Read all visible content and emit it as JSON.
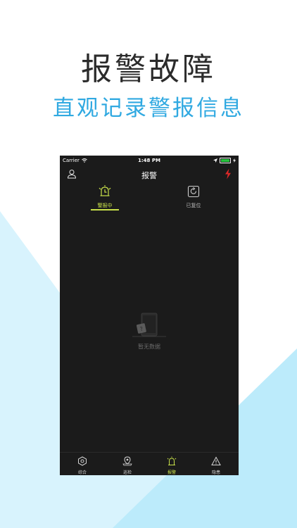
{
  "promo": {
    "headline": "报警故障",
    "subline": "直观记录警报信息"
  },
  "colors": {
    "accent_blue": "#30a9e1",
    "accent_green": "#c8e04a",
    "alert_red": "#e02828",
    "phone_bg": "#1b1b1b"
  },
  "phone": {
    "status": {
      "carrier": "Carrier",
      "time": "1:48 PM"
    },
    "nav": {
      "title": "报警",
      "left_icon": "user-icon",
      "right_icon": "lightning-icon"
    },
    "tabs": [
      {
        "label": "警报中",
        "icon": "alarm-clock-icon",
        "active": true
      },
      {
        "label": "已复位",
        "icon": "refresh-icon",
        "active": false
      }
    ],
    "empty_state": {
      "text": "暂无数据",
      "icon": "empty-device-icon"
    },
    "bottom_nav": [
      {
        "label": "综合",
        "icon": "hexagon-icon",
        "active": false
      },
      {
        "label": "巡检",
        "icon": "location-pin-icon",
        "active": false
      },
      {
        "label": "报警",
        "icon": "siren-icon",
        "active": true
      },
      {
        "label": "隐患",
        "icon": "warning-triangle-icon",
        "active": false
      }
    ]
  }
}
